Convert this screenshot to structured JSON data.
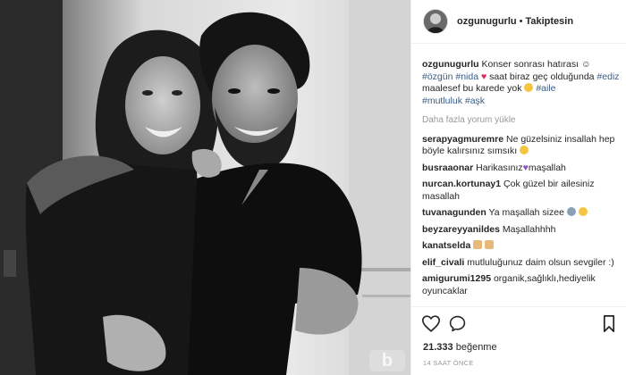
{
  "header": {
    "username": "ozgunugurlu",
    "separator": "•",
    "follow_status": "Takiptesin"
  },
  "caption": {
    "username": "ozgunugurlu",
    "text1": "Konser sonrası hatırası",
    "tag1": "#özgün",
    "tag2": "#nida",
    "text2": "saat biraz geç olduğunda",
    "tag3": "#ediz",
    "text3": "maalesef bu karede yok",
    "tag4": "#aile",
    "tag5": "#mutluluk",
    "tag6": "#aşk"
  },
  "load_more": "Daha fazla yorum yükle",
  "comments": [
    {
      "user": "serapyagmuremre",
      "text": "Ne güzelsiniz insallah hep böyle kalırsınız sımsıkı"
    },
    {
      "user": "busraaonar",
      "text": "Harikasınız",
      "text_after": "maşallah"
    },
    {
      "user": "nurcan.kortunay1",
      "text": "Çok güzel bir ailesiniz masallah"
    },
    {
      "user": "tuvanagunden",
      "text": "Ya maşallah sizee"
    },
    {
      "user": "beyzareyyanildes",
      "text": "Maşallahhhh"
    },
    {
      "user": "kanatselda",
      "text": ""
    },
    {
      "user": "elif_civali",
      "text": "mutluluğunuz daim olsun sevgiler :)"
    },
    {
      "user": "amigurumi1295",
      "text": "organik,sağlıklı,hediyelik oyuncaklar"
    }
  ],
  "likes": {
    "count": "21.333",
    "label": "beğenme"
  },
  "timestamp": "14 SAAT ÖNCE",
  "icons": [
    "heart-icon",
    "comment-icon",
    "bookmark-icon"
  ],
  "colors": {
    "hashtag": "#3b5c86",
    "heart": "#e0245e",
    "purple_heart": "#8c52c8"
  }
}
